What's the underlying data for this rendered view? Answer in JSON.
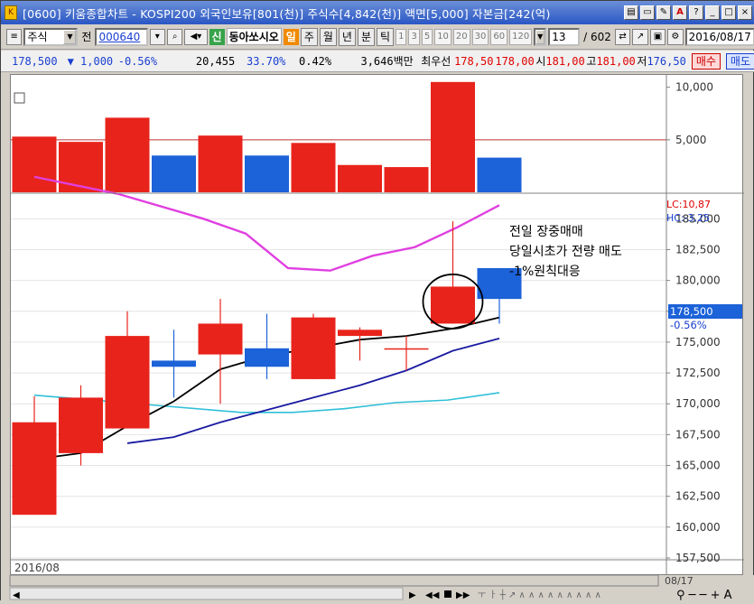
{
  "window": {
    "title": "[0600] 키움종합차트 - KOSPI200 외국인보유[801(천)] 주식수[4,842(천)] 액면[5,000] 자본금[242(억)",
    "buttons": [
      "목록",
      "창",
      "메모",
      "A",
      "?",
      "_",
      "□",
      "×"
    ]
  },
  "toolbar": {
    "market_type": "주식",
    "code_prefix": "전",
    "stock_code": "000640",
    "new_label": "신",
    "stock_name": "동아쏘시오",
    "day_label": "일",
    "periods": [
      "주",
      "월",
      "년",
      "분",
      "틱"
    ],
    "minute_options": [
      "1",
      "3",
      "5",
      "10",
      "20",
      "30",
      "60",
      "120"
    ],
    "count_value": "13",
    "count_total": "/ 602",
    "date_value": "2016/08/17"
  },
  "infobar": {
    "price": "178,500",
    "change": "▼ 1,000",
    "change_pct": "-0.56%",
    "volume": "20,455",
    "turnover_pct": "33.70%",
    "vol_pct": "0.42%",
    "amount": "3,646백만",
    "best_label": "최우선",
    "best_bid": "178,50",
    "best_ask": "178,00",
    "open_label": "시",
    "open": "181,00",
    "high_label": "고",
    "high": "181,00",
    "low_label": "저",
    "low": "176,50",
    "buy_label": "매수",
    "sell_label": "매도"
  },
  "annotation": {
    "line1": "전일 장중매매",
    "line2": "당일시초가 전량 매도",
    "line3": "-1%원칙대응"
  },
  "price_axis_labels": [
    "185,000",
    "182,500",
    "180,000",
    "177,500",
    "175,000",
    "172,500",
    "170,000",
    "167,500",
    "165,000",
    "162,500",
    "160,000",
    "157,500"
  ],
  "price_badge": {
    "price": "178,500",
    "pct": "-0.56%",
    "lc": "LC:10,87",
    "hc": "HC:-3,25"
  },
  "volume_axis_labels": [
    "10,000",
    "5,000"
  ],
  "date_left": "2016/08",
  "date_right": "08/17",
  "colors": {
    "up": "#e8231b",
    "down": "#1c62d8",
    "ma5": "#000000",
    "ma10": "#1a1aa0",
    "ma20": "#e040e0",
    "ma60": "#30c0d8"
  },
  "chart_data": {
    "type": "candlestick",
    "candles": [
      {
        "open": 161000,
        "high": 170600,
        "low": 161000,
        "close": 168500
      },
      {
        "open": 166000,
        "high": 171500,
        "low": 165000,
        "close": 170500
      },
      {
        "open": 168000,
        "high": 177500,
        "low": 168000,
        "close": 175500
      },
      {
        "open": 173500,
        "high": 176000,
        "low": 170500,
        "close": 173000
      },
      {
        "open": 174000,
        "high": 178500,
        "low": 170000,
        "close": 176500
      },
      {
        "open": 174500,
        "high": 177300,
        "low": 172000,
        "close": 173000
      },
      {
        "open": 172000,
        "high": 177300,
        "low": 172000,
        "close": 177000
      },
      {
        "open": 175500,
        "high": 176200,
        "low": 173500,
        "close": 176000
      },
      {
        "open": 174500,
        "high": 175500,
        "low": 172700,
        "close": 174500
      },
      {
        "open": 176500,
        "high": 184800,
        "low": 176500,
        "close": 179500
      },
      {
        "open": 181000,
        "high": 181000,
        "low": 176500,
        "close": 178500
      }
    ],
    "ma5": [
      165500,
      166000,
      168200,
      170200,
      172800,
      173900,
      174500,
      175200,
      175500,
      176100,
      177000
    ],
    "ma10": [
      null,
      null,
      166800,
      167300,
      168500,
      169500,
      170500,
      171500,
      172700,
      174300,
      175300
    ],
    "ma20": [
      188400,
      null,
      187000,
      null,
      185000,
      183800,
      181000,
      180800,
      182000,
      182700,
      184300,
      186100
    ],
    "ma60": [
      170700,
      null,
      170000,
      null,
      169300,
      169300,
      169600,
      170100,
      170300,
      170900
    ],
    "volumes": [
      5300,
      4800,
      7100,
      3500,
      5400,
      3500,
      4700,
      2600,
      2400,
      10500,
      3300
    ],
    "y_range": [
      157500,
      187000
    ],
    "volume_range": [
      0,
      11000
    ],
    "grid": true
  }
}
